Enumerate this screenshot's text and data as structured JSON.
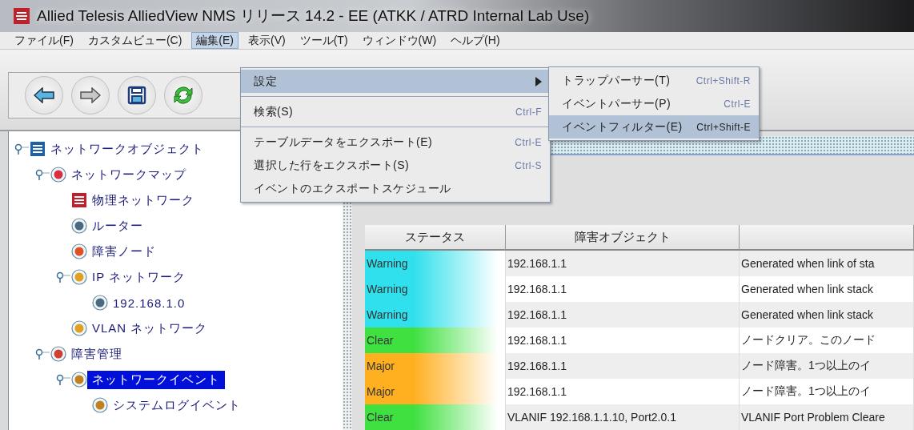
{
  "window": {
    "title": "Allied Telesis AlliedView NMS リリース 14.2  -  EE  (ATKK / ATRD  Internal  Lab Use)"
  },
  "menu_bar": [
    {
      "label": "ファイル(F)",
      "selected": false
    },
    {
      "label": "カスタムビュー(C)",
      "selected": false
    },
    {
      "label": "編集(E)",
      "selected": true
    },
    {
      "label": "表示(V)",
      "selected": false
    },
    {
      "label": "ツール(T)",
      "selected": false
    },
    {
      "label": "ウィンドウ(W)",
      "selected": false
    },
    {
      "label": "ヘルプ(H)",
      "selected": false
    }
  ],
  "toolbar": [
    {
      "kind": "back"
    },
    {
      "kind": "forward"
    },
    {
      "kind": "save"
    },
    {
      "kind": "refresh"
    }
  ],
  "edit_menu": [
    {
      "kind": "submenu",
      "label": "設定",
      "selected": true
    },
    {
      "kind": "separator"
    },
    {
      "kind": "item",
      "label": "検索(S)",
      "shortcut": "Ctrl-F",
      "selected": false
    },
    {
      "kind": "separator"
    },
    {
      "kind": "item",
      "label": "テーブルデータをエクスポート(E)",
      "shortcut": "Ctrl-E",
      "selected": false
    },
    {
      "kind": "item",
      "label": "選択した行をエクスポート(S)",
      "shortcut": "Ctrl-S",
      "selected": false
    },
    {
      "kind": "item",
      "label": "イベントのエクスポートスケジュール",
      "selected": false
    }
  ],
  "settings_submenu": [
    {
      "label": "トラップパーサー(T)",
      "shortcut": "Ctrl+Shift-R",
      "selected": false
    },
    {
      "label": "イベントパーサー(P)",
      "shortcut": "Ctrl-E",
      "selected": false
    },
    {
      "label": "イベントフィルター(E)",
      "shortcut": "Ctrl+Shift-E",
      "selected": true
    }
  ],
  "tree": [
    {
      "label": "ネットワークオブジェクト",
      "expanded": true,
      "selected": false,
      "children": [
        {
          "label": "ネットワークマップ",
          "expanded": true,
          "selected": false,
          "children": [
            {
              "label": "物理ネットワーク",
              "selected": false
            },
            {
              "label": "ルーター",
              "selected": false
            },
            {
              "label": "障害ノード",
              "selected": false
            },
            {
              "label": "IP ネットワーク",
              "expanded": true,
              "selected": false,
              "children": [
                {
                  "label": "192.168.1.0",
                  "selected": false
                }
              ]
            },
            {
              "label": "VLAN ネットワーク",
              "selected": false
            }
          ]
        },
        {
          "label": "障害管理",
          "expanded": true,
          "selected": false,
          "children": [
            {
              "label": "ネットワークイベント",
              "expanded": true,
              "selected": true,
              "children": [
                {
                  "label": "システムログイベント",
                  "selected": false
                }
              ]
            }
          ]
        }
      ]
    }
  ],
  "table": {
    "columns": [
      "ステータス",
      "障害オブジェクト"
    ],
    "rows": [
      {
        "status": "Warning",
        "color": "#30e0ec",
        "object": "192.168.1.1",
        "description": "Generated when link of sta"
      },
      {
        "status": "Warning",
        "color": "#30e0ec",
        "object": "192.168.1.1",
        "description": "Generated when link stack"
      },
      {
        "status": "Warning",
        "color": "#30e0ec",
        "object": "192.168.1.1",
        "description": "Generated when link stack"
      },
      {
        "status": "Clear",
        "color": "#40e040",
        "object": "192.168.1.1",
        "description": "ノードクリア。このノード"
      },
      {
        "status": "Major",
        "color": "#ffb020",
        "object": "192.168.1.1",
        "description": "ノード障害。1つ以上のイ"
      },
      {
        "status": "Major",
        "color": "#ffb020",
        "object": "192.168.1.1",
        "description": "ノード障害。1つ以上のイ"
      },
      {
        "status": "Clear",
        "color": "#40e040",
        "object": "VLANIF 192.168.1.1.10, Port2.0.1",
        "description": "VLANIF Port Problem Cleare"
      }
    ]
  }
}
